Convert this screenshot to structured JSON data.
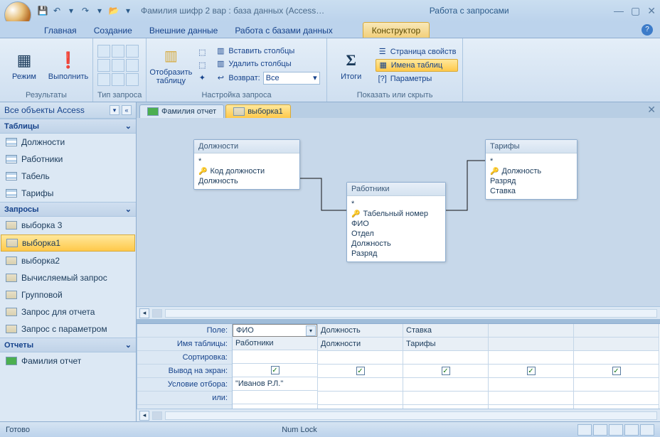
{
  "title": "Фамилия шифр 2 вар : база данных (Access…",
  "contextual_title": "Работа с запросами",
  "qat": {
    "save": "💾",
    "undo": "↶",
    "redo": "↷",
    "open": "📂"
  },
  "tabs": {
    "home": "Главная",
    "create": "Создание",
    "external": "Внешние данные",
    "dbtools": "Работа с базами данных",
    "designer": "Конструктор"
  },
  "ribbon": {
    "g1": {
      "view": "Режим",
      "run": "Выполнить",
      "label": "Результаты",
      "run_icon": "❗"
    },
    "g2": {
      "label": "Тип запроса"
    },
    "g3": {
      "show_table": "Отобразить\nтаблицу",
      "insert_cols": "Вставить столбцы",
      "delete_cols": "Удалить столбцы",
      "return_lbl": "Возврат:",
      "return_val": "Все",
      "label": "Настройка запроса"
    },
    "g4": {
      "totals": "Итоги",
      "totals_icon": "Σ",
      "prop_sheet": "Страница свойств",
      "table_names": "Имена таблиц",
      "parameters": "Параметры",
      "label": "Показать или скрыть"
    }
  },
  "nav": {
    "title": "Все объекты Access",
    "groups": {
      "tables": {
        "label": "Таблицы",
        "items": [
          "Должности",
          "Работники",
          "Табель",
          "Тарифы"
        ]
      },
      "queries": {
        "label": "Запросы",
        "items": [
          "выборка 3",
          "выборка1",
          "выборка2",
          "Вычисляемый запрос",
          "Групповой",
          "Запрос для отчета",
          "Запрос с параметром"
        ]
      },
      "reports": {
        "label": "Отчеты",
        "items": [
          "Фамилия отчет"
        ]
      }
    },
    "selected": "выборка1"
  },
  "doctabs": {
    "tab1": "Фамилия отчет",
    "tab2": "выборка1"
  },
  "designer": {
    "t1": {
      "title": "Должности",
      "fields": [
        "*",
        "Код должности",
        "Должность"
      ],
      "key": 1
    },
    "t2": {
      "title": "Работники",
      "fields": [
        "*",
        "Табельный номер",
        "ФИО",
        "Отдел",
        "Должность",
        "Разряд"
      ],
      "key": 1
    },
    "t3": {
      "title": "Тарифы",
      "fields": [
        "*",
        "Должность",
        "Разряд",
        "Ставка"
      ],
      "key": 1
    }
  },
  "grid": {
    "labels": {
      "field": "Поле:",
      "table": "Имя таблицы:",
      "sort": "Сортировка:",
      "show": "Вывод на экран:",
      "criteria": "Условие отбора:",
      "or": "или:"
    },
    "cols": [
      {
        "field": "ФИО",
        "table": "Работники",
        "show": true,
        "criteria": "\"Иванов Р.Л.\""
      },
      {
        "field": "Должность",
        "table": "Должности",
        "show": true,
        "criteria": ""
      },
      {
        "field": "Ставка",
        "table": "Тарифы",
        "show": true,
        "criteria": ""
      },
      {
        "field": "",
        "table": "",
        "show": true,
        "criteria": ""
      },
      {
        "field": "",
        "table": "",
        "show": true,
        "criteria": ""
      }
    ]
  },
  "status": {
    "ready": "Готово",
    "numlock": "Num Lock"
  }
}
